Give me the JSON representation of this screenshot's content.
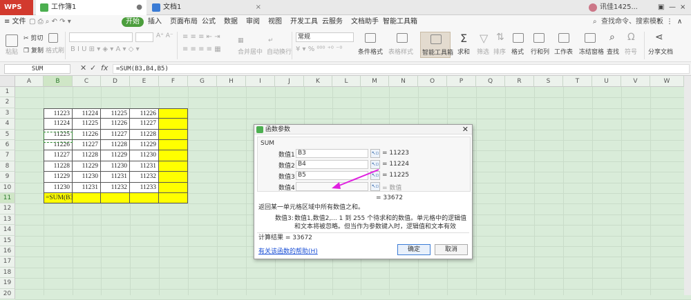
{
  "titlebar": {
    "app_tab": "WPS",
    "tabs": [
      {
        "label": "工作簿1",
        "active": true
      },
      {
        "label": "文档1",
        "active": false
      }
    ],
    "user": "讯佳1425..."
  },
  "menubar": {
    "file": "≡ 文件",
    "start": "开始",
    "items": [
      "插入",
      "页面布局",
      "公式",
      "数据",
      "审阅",
      "视图",
      "开发工具",
      "云服务",
      "文档助手",
      "智能工具箱"
    ],
    "search": "查找命令、搜索模板"
  },
  "ribbon": {
    "paste": "粘贴",
    "cut": "剪切",
    "copy": "复制",
    "format_painter": "格式刷",
    "merge": "合并居中",
    "wrap": "自动换行",
    "number_format": "常规",
    "cond_format": "条件格式",
    "table_style": "表格样式",
    "smart_tools": "智能工具箱",
    "sum": "求和",
    "filter": "筛选",
    "sort": "排序",
    "format": "格式",
    "rowcol": "行和列",
    "sheet": "工作表",
    "freeze": "冻结窗格",
    "find": "查找",
    "symbol": "符号",
    "share": "分享文档"
  },
  "formula_bar": {
    "name_box": "SUM",
    "formula": "=SUM(B3,B4,B5)"
  },
  "columns": [
    "A",
    "B",
    "C",
    "D",
    "E",
    "F",
    "G",
    "H",
    "I",
    "J",
    "K",
    "L",
    "M",
    "N",
    "O",
    "P",
    "Q",
    "R",
    "S",
    "T",
    "U",
    "V",
    "W"
  ],
  "rows": [
    "1",
    "2",
    "3",
    "4",
    "5",
    "6",
    "7",
    "8",
    "9",
    "10",
    "11",
    "12",
    "13",
    "14",
    "15",
    "16",
    "17",
    "18",
    "19",
    "20"
  ],
  "table": [
    [
      "11223",
      "11224",
      "11225",
      "11226",
      ""
    ],
    [
      "11224",
      "11225",
      "11226",
      "11227",
      ""
    ],
    [
      "11225",
      "11226",
      "11227",
      "11228",
      ""
    ],
    [
      "11226",
      "11227",
      "11228",
      "11229",
      ""
    ],
    [
      "11227",
      "11228",
      "11229",
      "11230",
      ""
    ],
    [
      "11228",
      "11229",
      "11230",
      "11231",
      ""
    ],
    [
      "11229",
      "11230",
      "11231",
      "11232",
      ""
    ],
    [
      "11230",
      "11231",
      "11232",
      "11233",
      ""
    ]
  ],
  "formula_cell": "=SUM(B3,B4,B5)",
  "dialog": {
    "title": "函数参数",
    "function_name": "SUM",
    "args": [
      {
        "label": "数值1",
        "value": "B3",
        "result": "= 11223"
      },
      {
        "label": "数值2",
        "value": "B4",
        "result": "= 11224"
      },
      {
        "label": "数值3",
        "value": "B5",
        "result": "= 11225"
      },
      {
        "label": "数值4",
        "value": "",
        "result": "= 数值"
      }
    ],
    "total": "= 33672",
    "description": "返回某一单元格区域中所有数值之和。",
    "param_label": "数值3:",
    "param_desc": "数值1,数值2,... 1 到 255 个待求和的数值。单元格中的逻辑值和文本将被忽略。但当作为参数键入时，逻辑值和文本有效",
    "calc_result": "计算结果 = 33672",
    "help_link": "有关该函数的帮助(H)",
    "ok": "确定",
    "cancel": "取消"
  },
  "colors": {
    "accent": "#4c9e3d",
    "highlight": "#ffff00",
    "annotation": "#e020e0"
  }
}
